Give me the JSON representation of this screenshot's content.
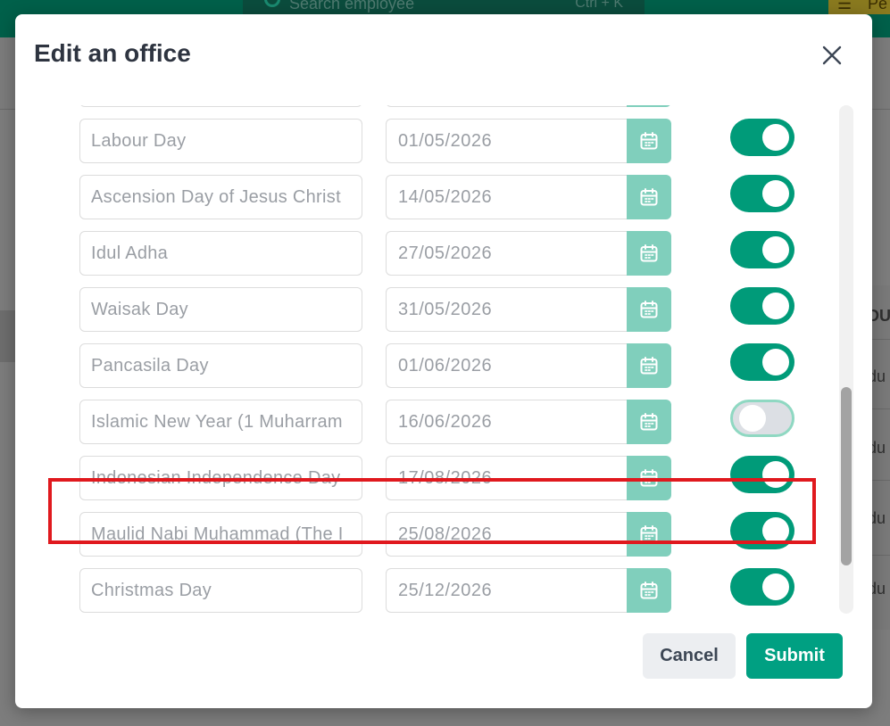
{
  "background": {
    "search_placeholder": "Search employee",
    "search_shortcut": "Ctrl + K",
    "chip_label": "Pe",
    "table_cells": [
      "DU",
      "du",
      "du",
      "du",
      "du"
    ]
  },
  "modal": {
    "title": "Edit an office",
    "close_label": "Close",
    "holidays": [
      {
        "name": "",
        "date": "",
        "enabled": true
      },
      {
        "name": "Labour Day",
        "date": "01/05/2026",
        "enabled": true
      },
      {
        "name": "Ascension Day of Jesus Christ",
        "date": "14/05/2026",
        "enabled": true
      },
      {
        "name": "Idul Adha",
        "date": "27/05/2026",
        "enabled": true
      },
      {
        "name": "Waisak Day",
        "date": "31/05/2026",
        "enabled": true
      },
      {
        "name": "Pancasila Day",
        "date": "01/06/2026",
        "enabled": true
      },
      {
        "name": "Islamic New Year (1 Muharram",
        "date": "16/06/2026",
        "enabled": false
      },
      {
        "name": "Indonesian Independence Day",
        "date": "17/08/2026",
        "enabled": true
      },
      {
        "name": "Maulid Nabi Muhammad (The I",
        "date": "25/08/2026",
        "enabled": true
      },
      {
        "name": "Christmas Day",
        "date": "25/12/2026",
        "enabled": true
      }
    ],
    "cancel_label": "Cancel",
    "submit_label": "Submit"
  },
  "colors": {
    "accent": "#009b79",
    "calendar_button": "#80cfbc",
    "highlight": "#e0191e"
  }
}
